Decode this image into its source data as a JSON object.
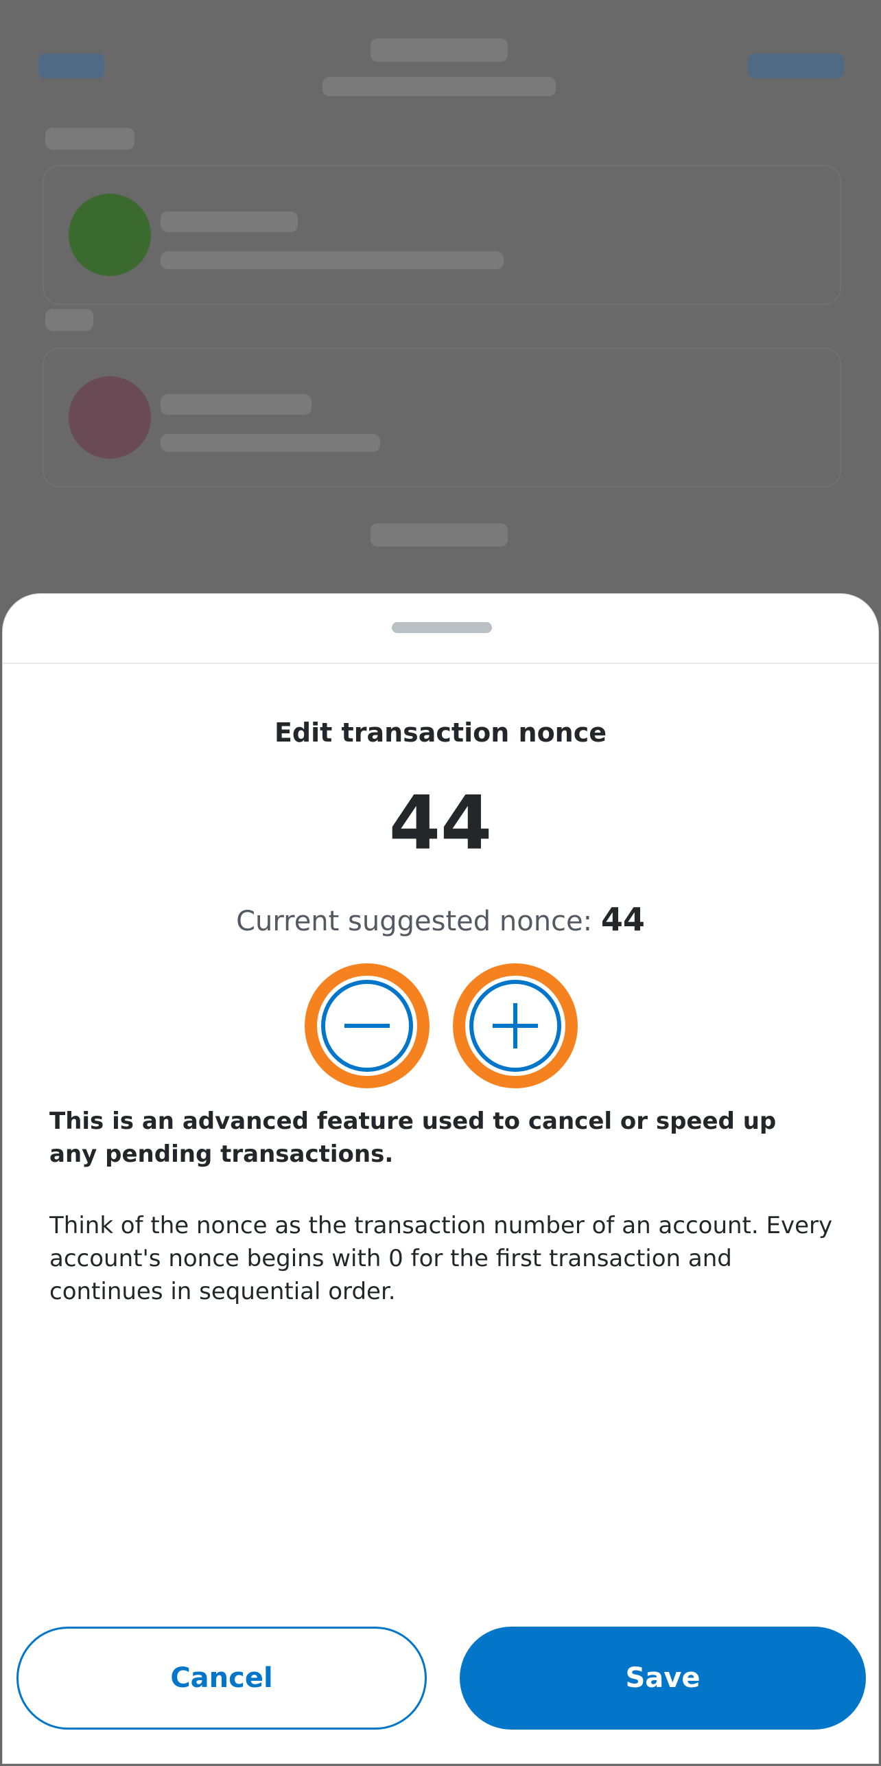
{
  "sheet": {
    "title": "Edit transaction nonce",
    "nonce_value": "44",
    "suggested_label": "Current suggested nonce:",
    "suggested_value": "44",
    "warning_text": "This is an advanced feature used to cancel or speed up any pending transactions.",
    "explain_text": "Think of the nonce as the transaction number of an account. Every account's nonce begins with 0 for the first transaction and continues in sequential order.",
    "decrement_icon": "minus-icon",
    "increment_icon": "plus-icon",
    "cancel_label": "Cancel",
    "save_label": "Save"
  },
  "colors": {
    "primary": "#0376c9",
    "stepper_highlight": "#f5821f",
    "text": "#24272a",
    "muted_text": "#535a61",
    "handle": "#bbc0c5"
  }
}
